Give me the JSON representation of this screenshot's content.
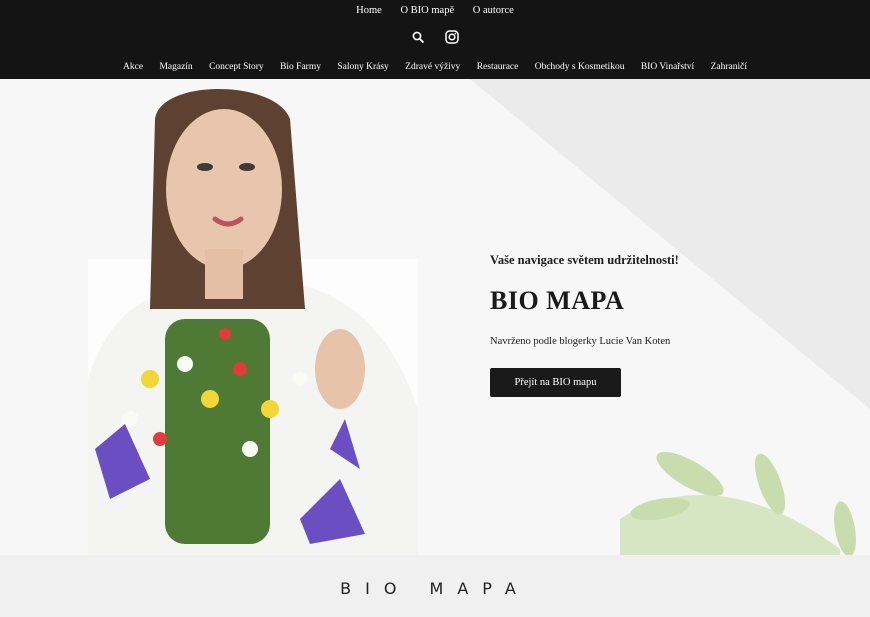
{
  "topnav": {
    "items": [
      "Home",
      "O BIO mapě",
      "O autorce"
    ]
  },
  "icons": {
    "search": "search-icon",
    "instagram": "instagram-icon"
  },
  "catnav": {
    "items": [
      "Akce",
      "Magazín",
      "Concept Story",
      "Bio Farmy",
      "Salony Krásy",
      "Zdravé výživy",
      "Restaurace",
      "Obchody s Kosmetikou",
      "BIO Vinařství",
      "Zahraničí"
    ]
  },
  "hero": {
    "tagline": "Vaše navigace světem udržitelnosti!",
    "title": "BIO MAPA",
    "subtitle": "Navrženo podle blogerky Lucie Van Koten",
    "cta": "Přejít na BIO mapu"
  },
  "footer": {
    "logo": "BIO MAPA"
  },
  "colors": {
    "header_bg": "#141414",
    "button_bg": "#1a1a1a",
    "leaf": "#b9d29a"
  }
}
